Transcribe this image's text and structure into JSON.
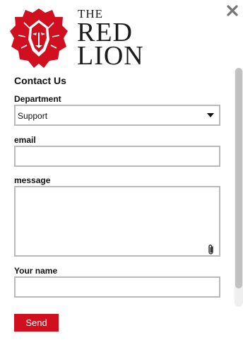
{
  "brand": {
    "line1": "THE",
    "line2": "RED",
    "line3": "LION",
    "accent_color": "#d0101f"
  },
  "icons": {
    "close": "close-icon",
    "logo": "lion-icon",
    "dropdown": "caret-down-icon",
    "attachment": "paperclip-icon"
  },
  "form": {
    "title": "Contact Us",
    "department": {
      "label": "Department",
      "selected": "Support"
    },
    "email": {
      "label": "email",
      "value": ""
    },
    "message": {
      "label": "message",
      "value": ""
    },
    "name": {
      "label": "Your name",
      "value": ""
    },
    "submit_label": "Send"
  }
}
